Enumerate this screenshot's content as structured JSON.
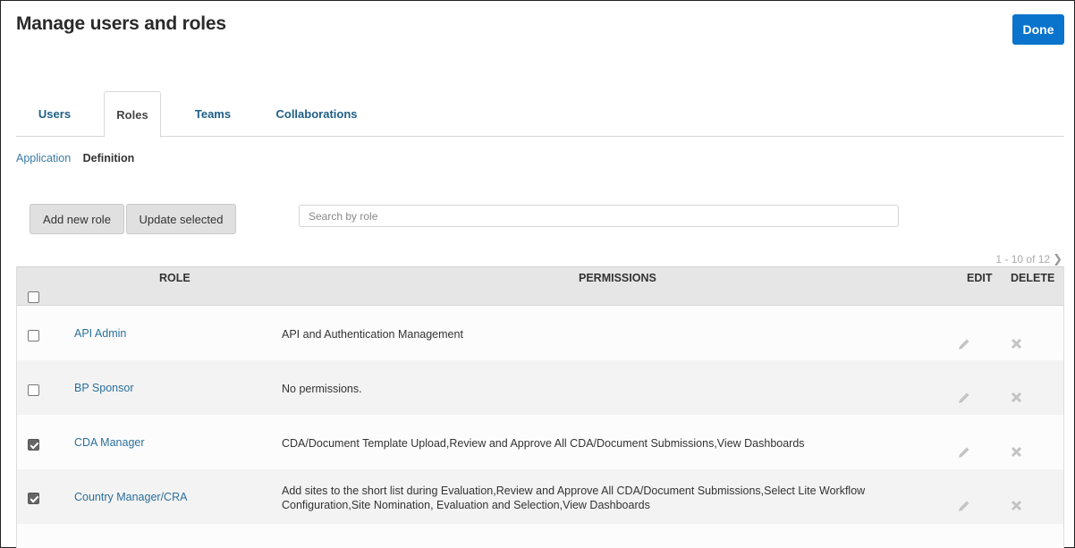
{
  "header": {
    "title": "Manage users and roles",
    "done_label": "Done"
  },
  "tabs": [
    {
      "label": "Users",
      "active": false
    },
    {
      "label": "Roles",
      "active": true
    },
    {
      "label": "Teams",
      "active": false
    },
    {
      "label": "Collaborations",
      "active": false
    }
  ],
  "subnav": {
    "items": [
      {
        "label": "Application",
        "active": false
      },
      {
        "label": "Definition",
        "active": true
      }
    ]
  },
  "toolbar": {
    "add_label": "Add new role",
    "update_label": "Update selected",
    "search_placeholder": "Search by role",
    "search_value": ""
  },
  "pagination": {
    "text": "1 - 10 of 12"
  },
  "table": {
    "columns": [
      "ROLE",
      "PERMISSIONS",
      "EDIT",
      "DELETE"
    ],
    "rows": [
      {
        "role": "API Admin",
        "permissions": "API and Authentication Management",
        "checked": false
      },
      {
        "role": "BP Sponsor",
        "permissions": "No permissions.",
        "checked": false
      },
      {
        "role": "CDA Manager",
        "permissions": "CDA/Document Template Upload,Review and Approve All CDA/Document Submissions,View Dashboards",
        "checked": true
      },
      {
        "role": "Country Manager/CRA",
        "permissions": "Add sites to the short list during Evaluation,Review and Approve All CDA/Document Submissions,Select Lite Workflow Configuration,Site Nomination, Evaluation and Selection,View Dashboards",
        "checked": true
      }
    ]
  },
  "colors": {
    "primary": "#0a74cc",
    "link": "#2a6f9a",
    "tab_link": "#1e5f86"
  }
}
